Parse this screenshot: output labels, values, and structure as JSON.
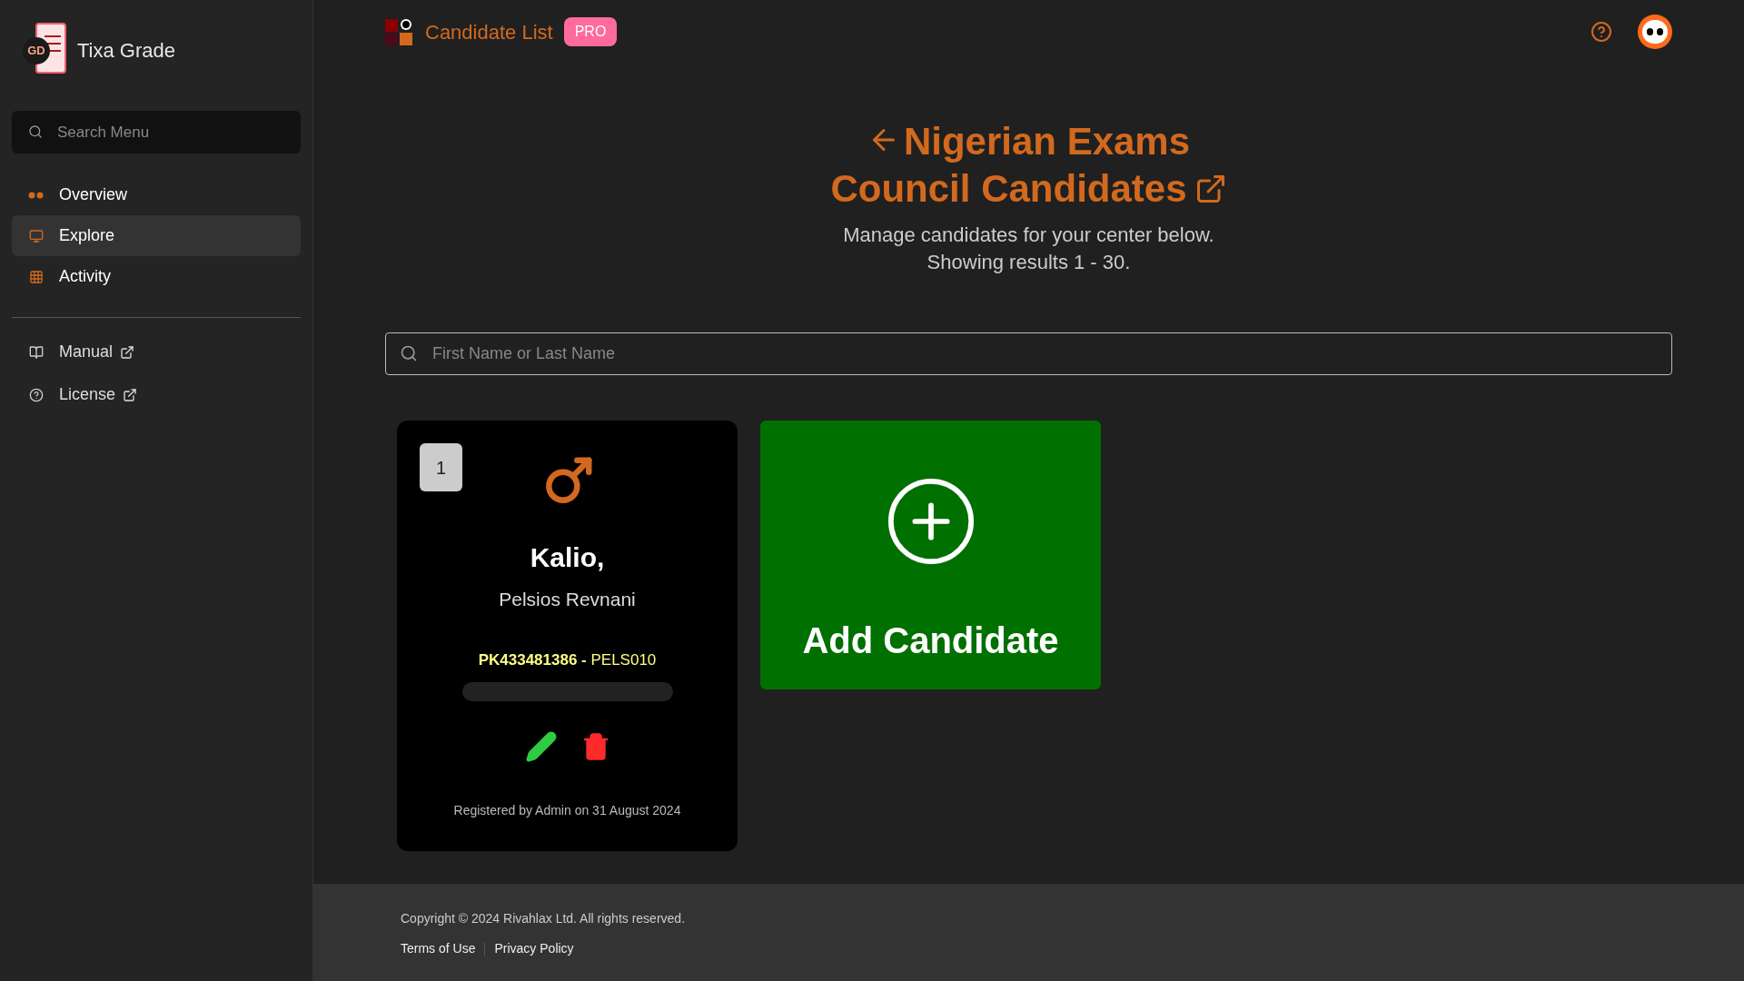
{
  "sidebar": {
    "brand": "Tixa Grade",
    "logo_text": "GD",
    "search": {
      "placeholder": "Search Menu"
    },
    "items": [
      {
        "label": "Overview",
        "selected": false
      },
      {
        "label": "Explore",
        "selected": true
      },
      {
        "label": "Activity",
        "selected": false
      }
    ],
    "links": [
      {
        "label": "Manual"
      },
      {
        "label": "License"
      }
    ]
  },
  "topbar": {
    "title": "Candidate List",
    "badge": "PRO"
  },
  "heading": {
    "title": "Nigerian Exams Council Candidates",
    "subtitle_lines": [
      "Manage candidates for your center below.",
      "Showing results 1 - 30."
    ]
  },
  "search": {
    "placeholder": "First Name or Last Name"
  },
  "candidates": [
    {
      "number": "1",
      "surname": "Kalio,",
      "given_names": "Pelsios Revnani",
      "code": "**PK433481386 -** PELS010",
      "registered": "Registered by Admin on 31 August 2024"
    }
  ],
  "add_card": {
    "label": "Add Candidate"
  },
  "footer": {
    "copyright": "Copyright © 2024 Rivahlax Ltd. All rights reserved.",
    "links": [
      "Terms of Use",
      "Privacy Policy"
    ]
  }
}
